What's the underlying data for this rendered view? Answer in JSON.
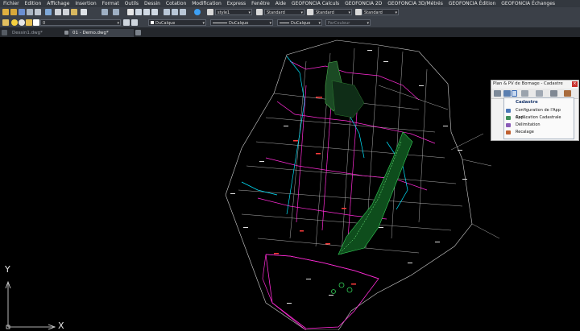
{
  "menu": [
    "Fichier",
    "Edition",
    "Affichage",
    "Insertion",
    "Format",
    "Outils",
    "Dessin",
    "Cotation",
    "Modification",
    "Express",
    "Fenêtre",
    "Aide",
    "GEOFONCIA Calculs",
    "GEOFONCIA 2D",
    "GEOFONCIA 3D/Métrés",
    "GEOFONCIA Édition",
    "GEOFONCIA Échanges"
  ],
  "toolbar1": {
    "textstyle": "style1",
    "dimstyle": "Standard",
    "tablestyle": "Standard",
    "mleaderstyle": "Standard"
  },
  "toolbar2": {
    "layer": "0",
    "color": "DuCalque",
    "linetype": "DuCalque",
    "lineweight": "DuCalque",
    "plotstyle": "ParCouleur"
  },
  "tabs": [
    "Dessin1.dwg*",
    "01 - Demo.dwg*"
  ],
  "ucs": {
    "y_label": "Y",
    "x_label": "X"
  },
  "panel": {
    "title": "Plan & PV de Bornage - Cadastre",
    "close_label": "×"
  },
  "dropdown": {
    "header": "Cadastre",
    "items": [
      "Configuration de l'App Cad...",
      "Application Cadastrale",
      "Délimitation",
      "Recalage"
    ]
  },
  "colors": {
    "menubar": "#33383f",
    "toolbar": "#3b4048",
    "canvas": "#000000",
    "accent_cyan": "#00e5ff",
    "accent_magenta": "#ff2bd6",
    "accent_green": "#35d35a"
  }
}
